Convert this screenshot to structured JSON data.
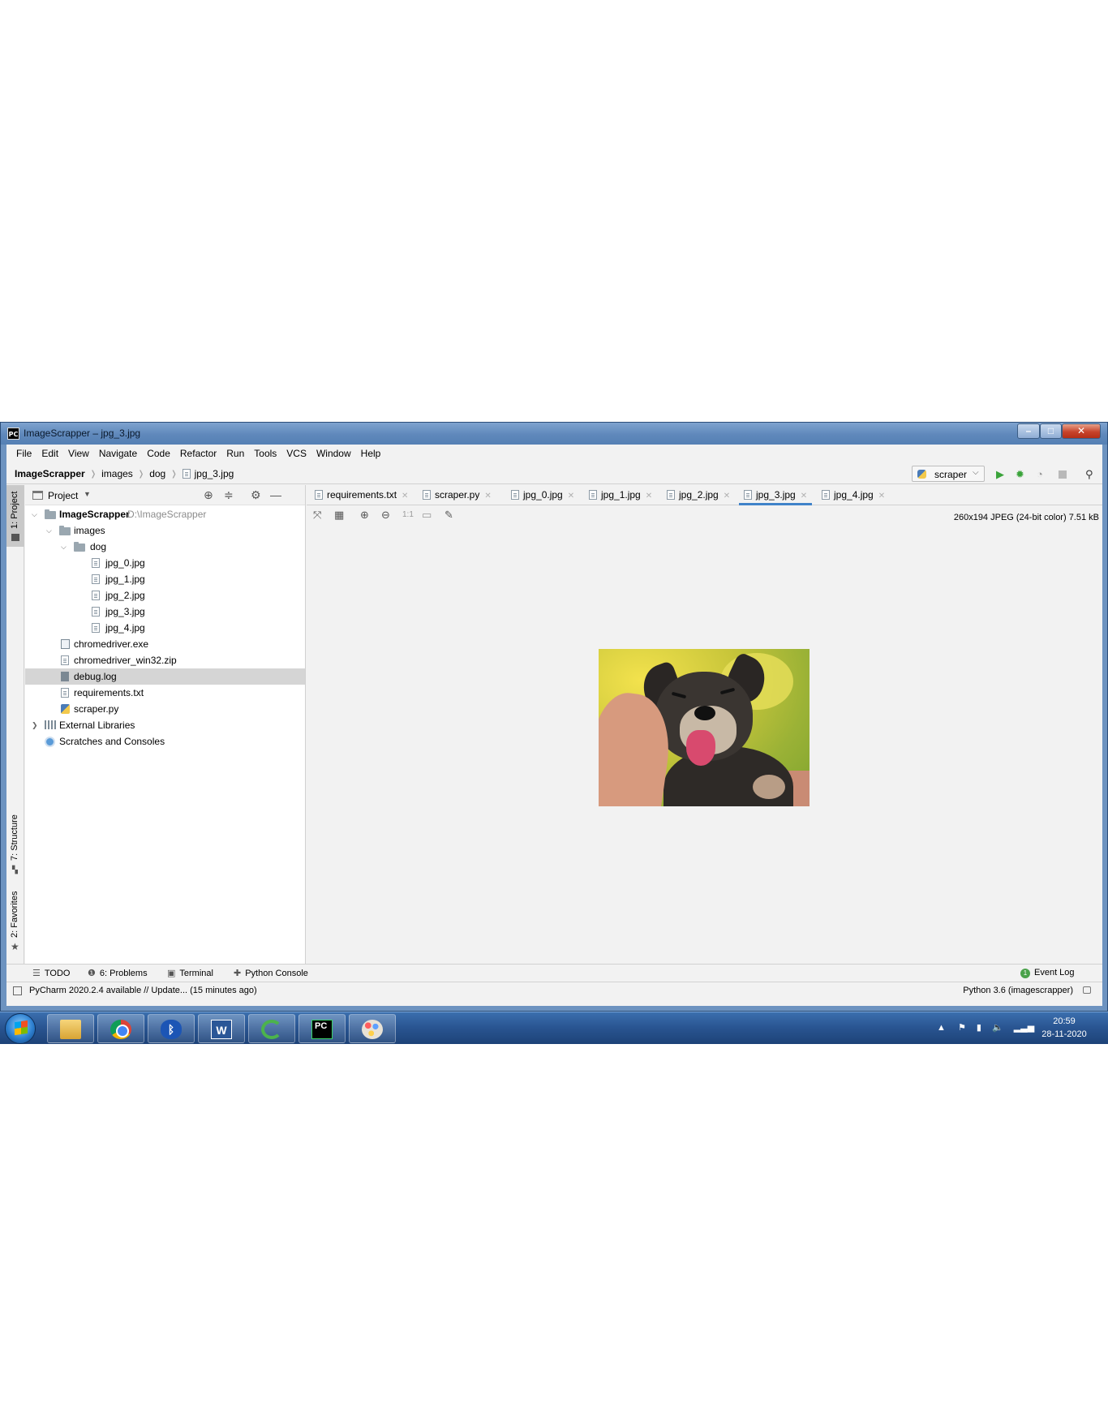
{
  "window": {
    "app_icon": "PC",
    "title": "ImageScrapper – jpg_3.jpg",
    "controls": [
      "minimize-icon",
      "maximize-icon",
      "close-icon"
    ]
  },
  "menu": [
    "File",
    "Edit",
    "View",
    "Navigate",
    "Code",
    "Refactor",
    "Run",
    "Tools",
    "VCS",
    "Window",
    "Help"
  ],
  "navbar": {
    "breadcrumbs": [
      "ImageScrapper",
      "images",
      "dog",
      "jpg_3.jpg"
    ],
    "run_config": "scraper",
    "icons": [
      "run-icon",
      "debug-icon",
      "coverage-icon",
      "stop-icon",
      "search-icon"
    ]
  },
  "left_stripe": {
    "project_tab": "1: Project",
    "structure_tab": "7: Structure",
    "favorites_tab": "2: Favorites"
  },
  "project": {
    "header": "Project",
    "tree": [
      {
        "name": "ImageScrapper",
        "path": "D:\\ImageScrapper"
      },
      {
        "name": "images"
      },
      {
        "name": "dog"
      },
      {
        "name": "jpg_0.jpg"
      },
      {
        "name": "jpg_1.jpg"
      },
      {
        "name": "jpg_2.jpg"
      },
      {
        "name": "jpg_3.jpg"
      },
      {
        "name": "jpg_4.jpg"
      },
      {
        "name": "chromedriver.exe"
      },
      {
        "name": "chromedriver_win32.zip"
      },
      {
        "name": "debug.log",
        "selected": true
      },
      {
        "name": "requirements.txt"
      },
      {
        "name": "scraper.py"
      },
      {
        "name": "External Libraries"
      },
      {
        "name": "Scratches and Consoles"
      }
    ]
  },
  "editor": {
    "tabs": [
      {
        "label": "requirements.txt"
      },
      {
        "label": "scraper.py"
      },
      {
        "label": "jpg_0.jpg"
      },
      {
        "label": "jpg_1.jpg"
      },
      {
        "label": "jpg_2.jpg"
      },
      {
        "label": "jpg_3.jpg",
        "active": true
      },
      {
        "label": "jpg_4.jpg"
      }
    ],
    "image_tools": [
      "zoom-to-fit-icon",
      "grid-icon",
      "zoom-in-icon",
      "zoom-out-icon",
      "actual-size-icon",
      "background-icon",
      "color-picker-icon"
    ],
    "actual_size_label": "1:1",
    "image_info": "260x194 JPEG (24-bit color) 7.51 kB"
  },
  "bottom_tools": {
    "todo": "TODO",
    "problems": "6: Problems",
    "terminal": "Terminal",
    "python_console": "Python Console",
    "event_log": "Event Log",
    "event_log_count": "1"
  },
  "status": {
    "message": "PyCharm 2020.2.4 available // Update... (15 minutes ago)",
    "interpreter": "Python 3.6 (imagescrapper)"
  },
  "taskbar": {
    "apps": [
      "windows-explorer-icon",
      "chrome-icon",
      "bluetooth-icon",
      "word-icon",
      "loading-app-icon",
      "pycharm-icon",
      "paint-icon"
    ],
    "time": "20:59",
    "date": "28-11-2020"
  }
}
